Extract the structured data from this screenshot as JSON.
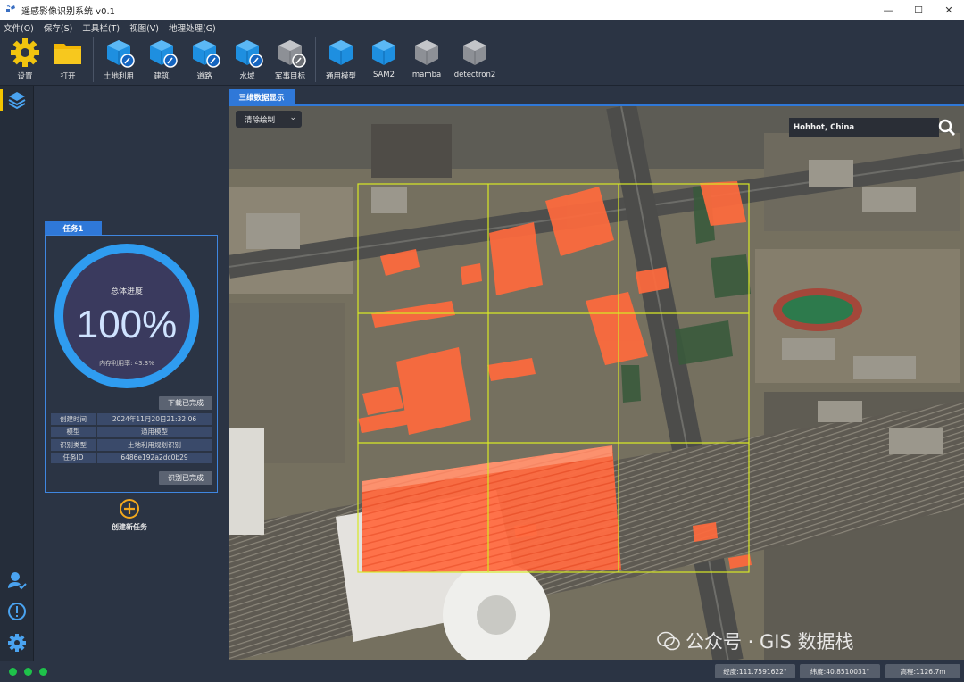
{
  "window": {
    "title": "遥感影像识别系统 v0.1",
    "min": "—",
    "max": "☐",
    "close": "✕"
  },
  "menu": [
    "文件(O)",
    "保存(S)",
    "工具栏(T)",
    "视图(V)",
    "地理处理(G)"
  ],
  "toolbar": {
    "settings": "设置",
    "open": "打开",
    "landuse": "土地利用",
    "building": "建筑",
    "road": "道路",
    "water": "水域",
    "military": "军事目标",
    "general": "通用模型",
    "sam2": "SAM2",
    "mamba": "mamba",
    "detectron2": "detectron2"
  },
  "task": {
    "tab": "任务1",
    "progress_title": "总体进度",
    "progress_value": "100%",
    "progress_fraction": 1.0,
    "memory": "内存利用率: 43.3%",
    "download_status": "下载已完成",
    "rows": [
      {
        "k": "创建时间",
        "v": "2024年11月20日21:32:06"
      },
      {
        "k": "模型",
        "v": "通用模型"
      },
      {
        "k": "识别类型",
        "v": "土地利用规划识别"
      },
      {
        "k": "任务ID",
        "v": "6486e192a2dc0b29"
      }
    ],
    "recognize_status": "识别已完成",
    "new_task": "创建新任务"
  },
  "view": {
    "tab": "三维数据显示",
    "clear_draw": "清除绘制",
    "search_value": "Hohhot, China",
    "watermark": "公众号 · GIS 数据栈"
  },
  "status": {
    "lon": "经度:111.7591622°",
    "lat": "纬度:40.8510031°",
    "alt": "高程:1126.7m"
  },
  "colors": {
    "accent": "#2f78d8",
    "highlight": "#ff6a3d",
    "grid": "#d8e826",
    "status_ok": "#1ec24a"
  }
}
